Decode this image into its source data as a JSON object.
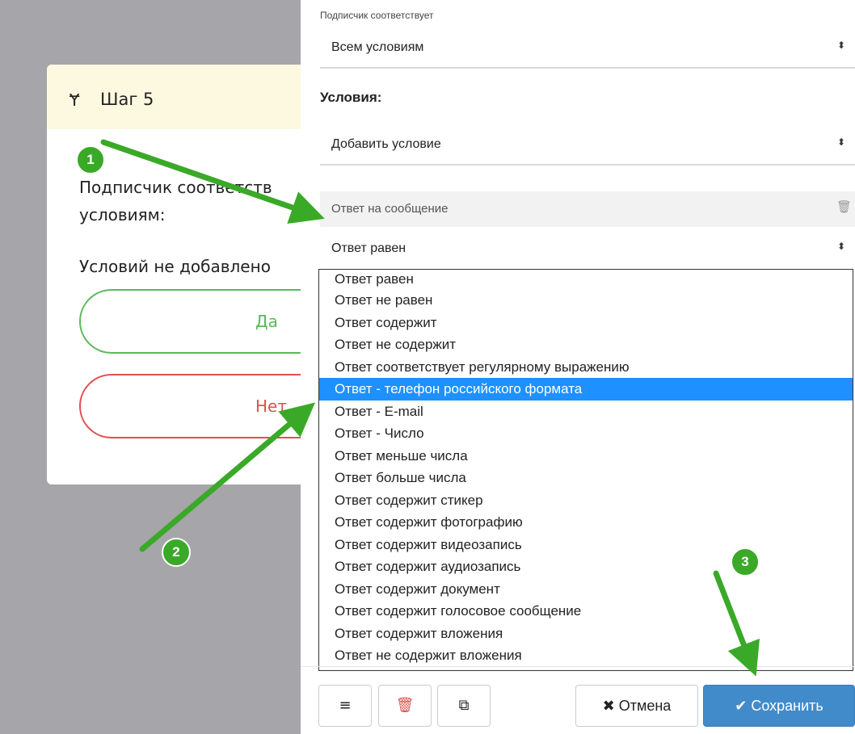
{
  "step_card": {
    "icon": "fork-icon",
    "title": "Шаг 5",
    "subscriber_line1": "Подписчик соответств",
    "subscriber_line2": "условиям:",
    "no_conditions": "Условий не добавлено",
    "yes_label": "Да",
    "no_label": "Нет"
  },
  "panel": {
    "match_label": "Подписчик соответствует",
    "match_value": "Всем условиям",
    "conditions_heading": "Условия:",
    "add_condition_value": "Добавить условие",
    "condition_block_label": "Ответ на сообщение",
    "answer_value": "Ответ равен",
    "arrow_glyph": "⬍",
    "trash_glyph": "🗑"
  },
  "dropdown": {
    "selected_index": 5,
    "options": [
      "Ответ равен",
      "Ответ не равен",
      "Ответ содержит",
      "Ответ не содержит",
      "Ответ соответствует регулярному выражению",
      "Ответ - телефон российского формата",
      "Ответ - E-mail",
      "Ответ - Число",
      "Ответ меньше числа",
      "Ответ больше числа",
      "Ответ содержит стикер",
      "Ответ содержит фотографию",
      "Ответ содержит видеозапись",
      "Ответ содержит аудиозапись",
      "Ответ содержит документ",
      "Ответ содержит голосовое сообщение",
      "Ответ содержит вложения",
      "Ответ не содержит вложения"
    ]
  },
  "footer": {
    "menu_icon": "≡",
    "delete_icon": "🗑",
    "copy_icon": "⧉",
    "cancel_label": "✖ Отмена",
    "save_label": "✔ Сохранить"
  },
  "annotations": {
    "badges": [
      "1",
      "2",
      "3"
    ]
  },
  "colors": {
    "annotation_green": "#3aa928",
    "selected_blue": "#1e90ff",
    "save_blue": "#428bca",
    "yes_green": "#5cb85c",
    "no_red": "#e05050"
  }
}
